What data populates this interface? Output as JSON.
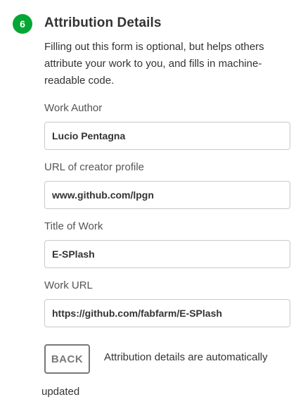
{
  "header": {
    "step_number": "6",
    "title": "Attribution Details",
    "badge_color": "#04a635"
  },
  "intro_text": "Filling out this form is optional, but helps others attribute your work to you, and fills in machine-readable code.",
  "fields": {
    "work_author": {
      "label": "Work Author",
      "value": "Lucio Pentagna"
    },
    "creator_profile_url": {
      "label": "URL of creator profile",
      "value": "www.github.com/lpgn"
    },
    "title_of_work": {
      "label": "Title of Work",
      "value": "E-SPlash"
    },
    "work_url": {
      "label": "Work URL",
      "value": "https://github.com/fabfarm/E-SPlash"
    }
  },
  "footer": {
    "back_label": "BACK",
    "status_line1": "Attribution details are automatically",
    "status_line2": "updated"
  }
}
